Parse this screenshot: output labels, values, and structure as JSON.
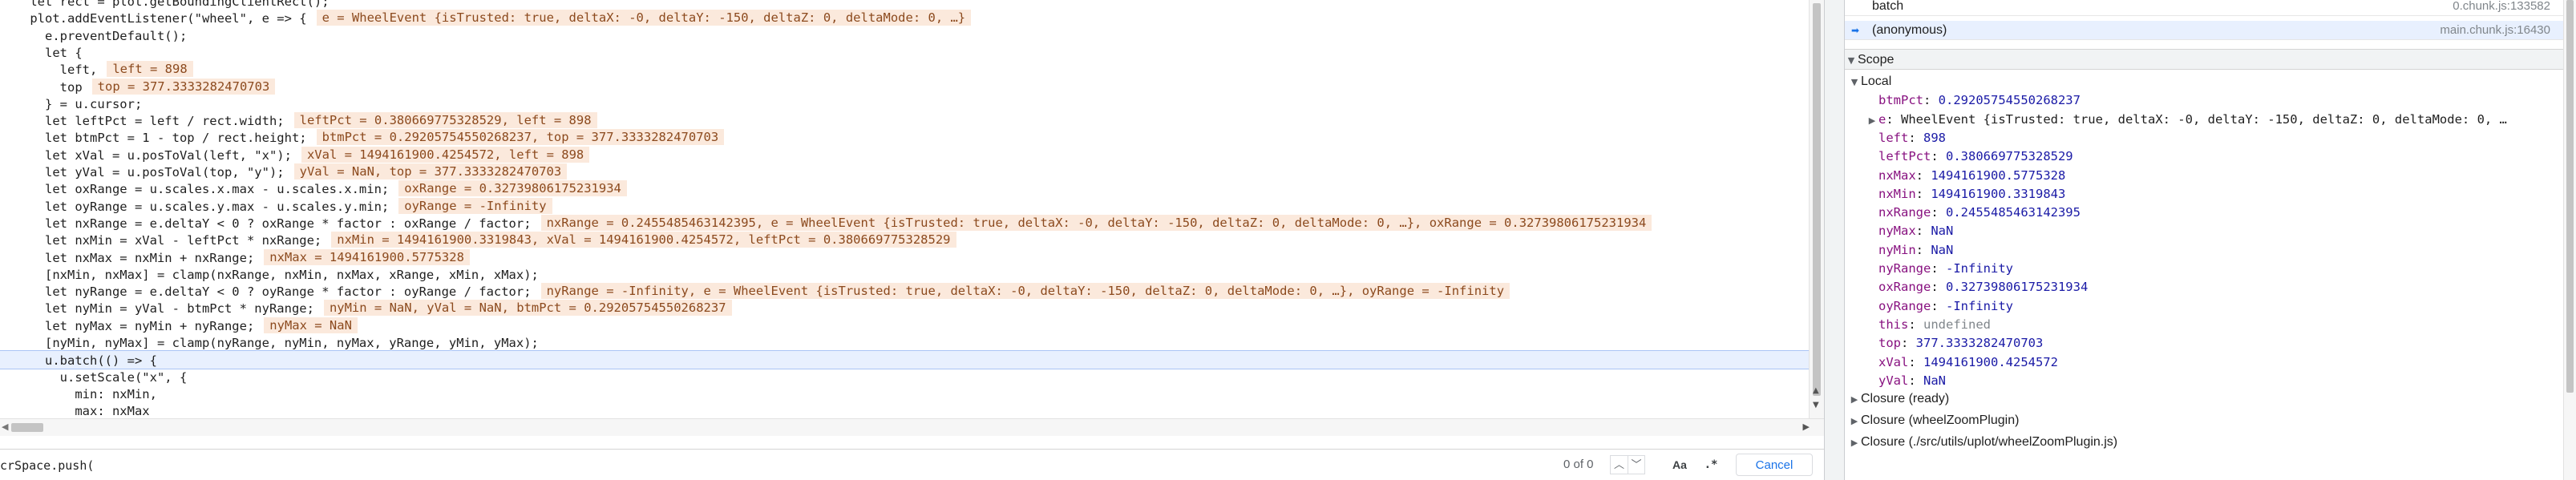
{
  "editor": {
    "lines": [
      {
        "code": "    let rect = plot.getBoundingClientRect();",
        "ann": ""
      },
      {
        "code": "    plot.addEventListener(\"wheel\", e => {",
        "ann": "e = WheelEvent {isTrusted: true, deltaX: -0, deltaY: -150, deltaZ: 0, deltaMode: 0, …}"
      },
      {
        "code": "      e.preventDefault();",
        "ann": ""
      },
      {
        "code": "      let {",
        "ann": ""
      },
      {
        "code": "        left,",
        "ann": "left = 898"
      },
      {
        "code": "        top",
        "ann": "top = 377.3333282470703"
      },
      {
        "code": "      } = u.cursor;",
        "ann": ""
      },
      {
        "code": "      let leftPct = left / rect.width;",
        "ann": "leftPct = 0.380669775328529, left = 898"
      },
      {
        "code": "      let btmPct = 1 - top / rect.height;",
        "ann": "btmPct = 0.29205754550268237, top = 377.3333282470703"
      },
      {
        "code": "      let xVal = u.posToVal(left, \"x\");",
        "ann": "xVal = 1494161900.4254572, left = 898"
      },
      {
        "code": "      let yVal = u.posToVal(top, \"y\");",
        "ann": "yVal = NaN, top = 377.3333282470703"
      },
      {
        "code": "      let oxRange = u.scales.x.max - u.scales.x.min;",
        "ann": "oxRange = 0.32739806175231934"
      },
      {
        "code": "      let oyRange = u.scales.y.max - u.scales.y.min;",
        "ann": "oyRange = -Infinity"
      },
      {
        "code": "      let nxRange = e.deltaY < 0 ? oxRange * factor : oxRange / factor;",
        "ann": "nxRange = 0.2455485463142395, e = WheelEvent {isTrusted: true, deltaX: -0, deltaY: -150, deltaZ: 0, deltaMode: 0, …}, oxRange = 0.32739806175231934"
      },
      {
        "code": "      let nxMin = xVal - leftPct * nxRange;",
        "ann": "nxMin = 1494161900.3319843, xVal = 1494161900.4254572, leftPct = 0.380669775328529"
      },
      {
        "code": "      let nxMax = nxMin + nxRange;",
        "ann": "nxMax = 1494161900.5775328"
      },
      {
        "code": "      [nxMin, nxMax] = clamp(nxRange, nxMin, nxMax, xRange, xMin, xMax);",
        "ann": ""
      },
      {
        "code": "      let nyRange = e.deltaY < 0 ? oyRange * factor : oyRange / factor;",
        "ann": "nyRange = -Infinity, e = WheelEvent {isTrusted: true, deltaX: -0, deltaY: -150, deltaZ: 0, deltaMode: 0, …}, oyRange = -Infinity"
      },
      {
        "code": "      let nyMin = yVal - btmPct * nyRange;",
        "ann": "nyMin = NaN, yVal = NaN, btmPct = 0.29205754550268237"
      },
      {
        "code": "      let nyMax = nyMin + nyRange;",
        "ann": "nyMax = NaN"
      },
      {
        "code": "      [nyMin, nyMax] = clamp(nyRange, nyMin, nyMax, yRange, yMin, yMax);",
        "ann": ""
      },
      {
        "code": "      u.batch(() => {",
        "ann": ""
      },
      {
        "code": "        u.setScale(\"x\", {",
        "ann": ""
      },
      {
        "code": "          min: nxMin,",
        "ann": ""
      },
      {
        "code": "          max: nxMax",
        "ann": ""
      },
      {
        "code": "        });",
        "ann": ""
      }
    ],
    "active_line_index": 21,
    "scroll_left_arrow": "◀",
    "scroll_right_arrow": "▶",
    "scroll_up_arrow": "▲",
    "scroll_down_arrow": "▼"
  },
  "search": {
    "value": "crSpace.push(",
    "match_count": "0 of 0",
    "prev_icon": "︿",
    "next_icon": "﹀",
    "match_case_label": "Aa",
    "regex_label": ".*",
    "cancel_label": "Cancel"
  },
  "call_stack": [
    {
      "name": "batch",
      "location": "0.chunk.js:133582",
      "selected": false
    },
    {
      "name": "(anonymous)",
      "location": "main.chunk.js:16430",
      "selected": true
    }
  ],
  "scope": {
    "header": "Scope",
    "local_label": "Local",
    "variables": [
      {
        "name": "btmPct",
        "value": "0.29205754550268237",
        "kind": "num",
        "expandable": false
      },
      {
        "name": "e",
        "value": "WheelEvent {isTrusted: true, deltaX: -0, deltaY: -150, deltaZ: 0, deltaMode: 0, …",
        "kind": "obj",
        "expandable": true
      },
      {
        "name": "left",
        "value": "898",
        "kind": "num",
        "expandable": false
      },
      {
        "name": "leftPct",
        "value": "0.380669775328529",
        "kind": "num",
        "expandable": false
      },
      {
        "name": "nxMax",
        "value": "1494161900.5775328",
        "kind": "num",
        "expandable": false
      },
      {
        "name": "nxMin",
        "value": "1494161900.3319843",
        "kind": "num",
        "expandable": false
      },
      {
        "name": "nxRange",
        "value": "0.2455485463142395",
        "kind": "num",
        "expandable": false
      },
      {
        "name": "nyMax",
        "value": "NaN",
        "kind": "num",
        "expandable": false
      },
      {
        "name": "nyMin",
        "value": "NaN",
        "kind": "num",
        "expandable": false
      },
      {
        "name": "nyRange",
        "value": "-Infinity",
        "kind": "num",
        "expandable": false
      },
      {
        "name": "oxRange",
        "value": "0.32739806175231934",
        "kind": "num",
        "expandable": false
      },
      {
        "name": "oyRange",
        "value": "-Infinity",
        "kind": "num",
        "expandable": false
      },
      {
        "name": "this",
        "value": "undefined",
        "kind": "undef",
        "expandable": false
      },
      {
        "name": "top",
        "value": "377.3333282470703",
        "kind": "num",
        "expandable": false
      },
      {
        "name": "xVal",
        "value": "1494161900.4254572",
        "kind": "num",
        "expandable": false
      },
      {
        "name": "yVal",
        "value": "NaN",
        "kind": "num",
        "expandable": false
      }
    ],
    "closures": [
      "Closure (ready)",
      "Closure (wheelZoomPlugin)",
      "Closure (./src/utils/uplot/wheelZoomPlugin.js)"
    ]
  },
  "colors": {
    "annotation_bg": "#fbe9dc",
    "active_line_bg": "#e8f0fe",
    "property_name": "#881280",
    "number_value": "#1a1aa6",
    "link_blue": "#1a73e8"
  }
}
